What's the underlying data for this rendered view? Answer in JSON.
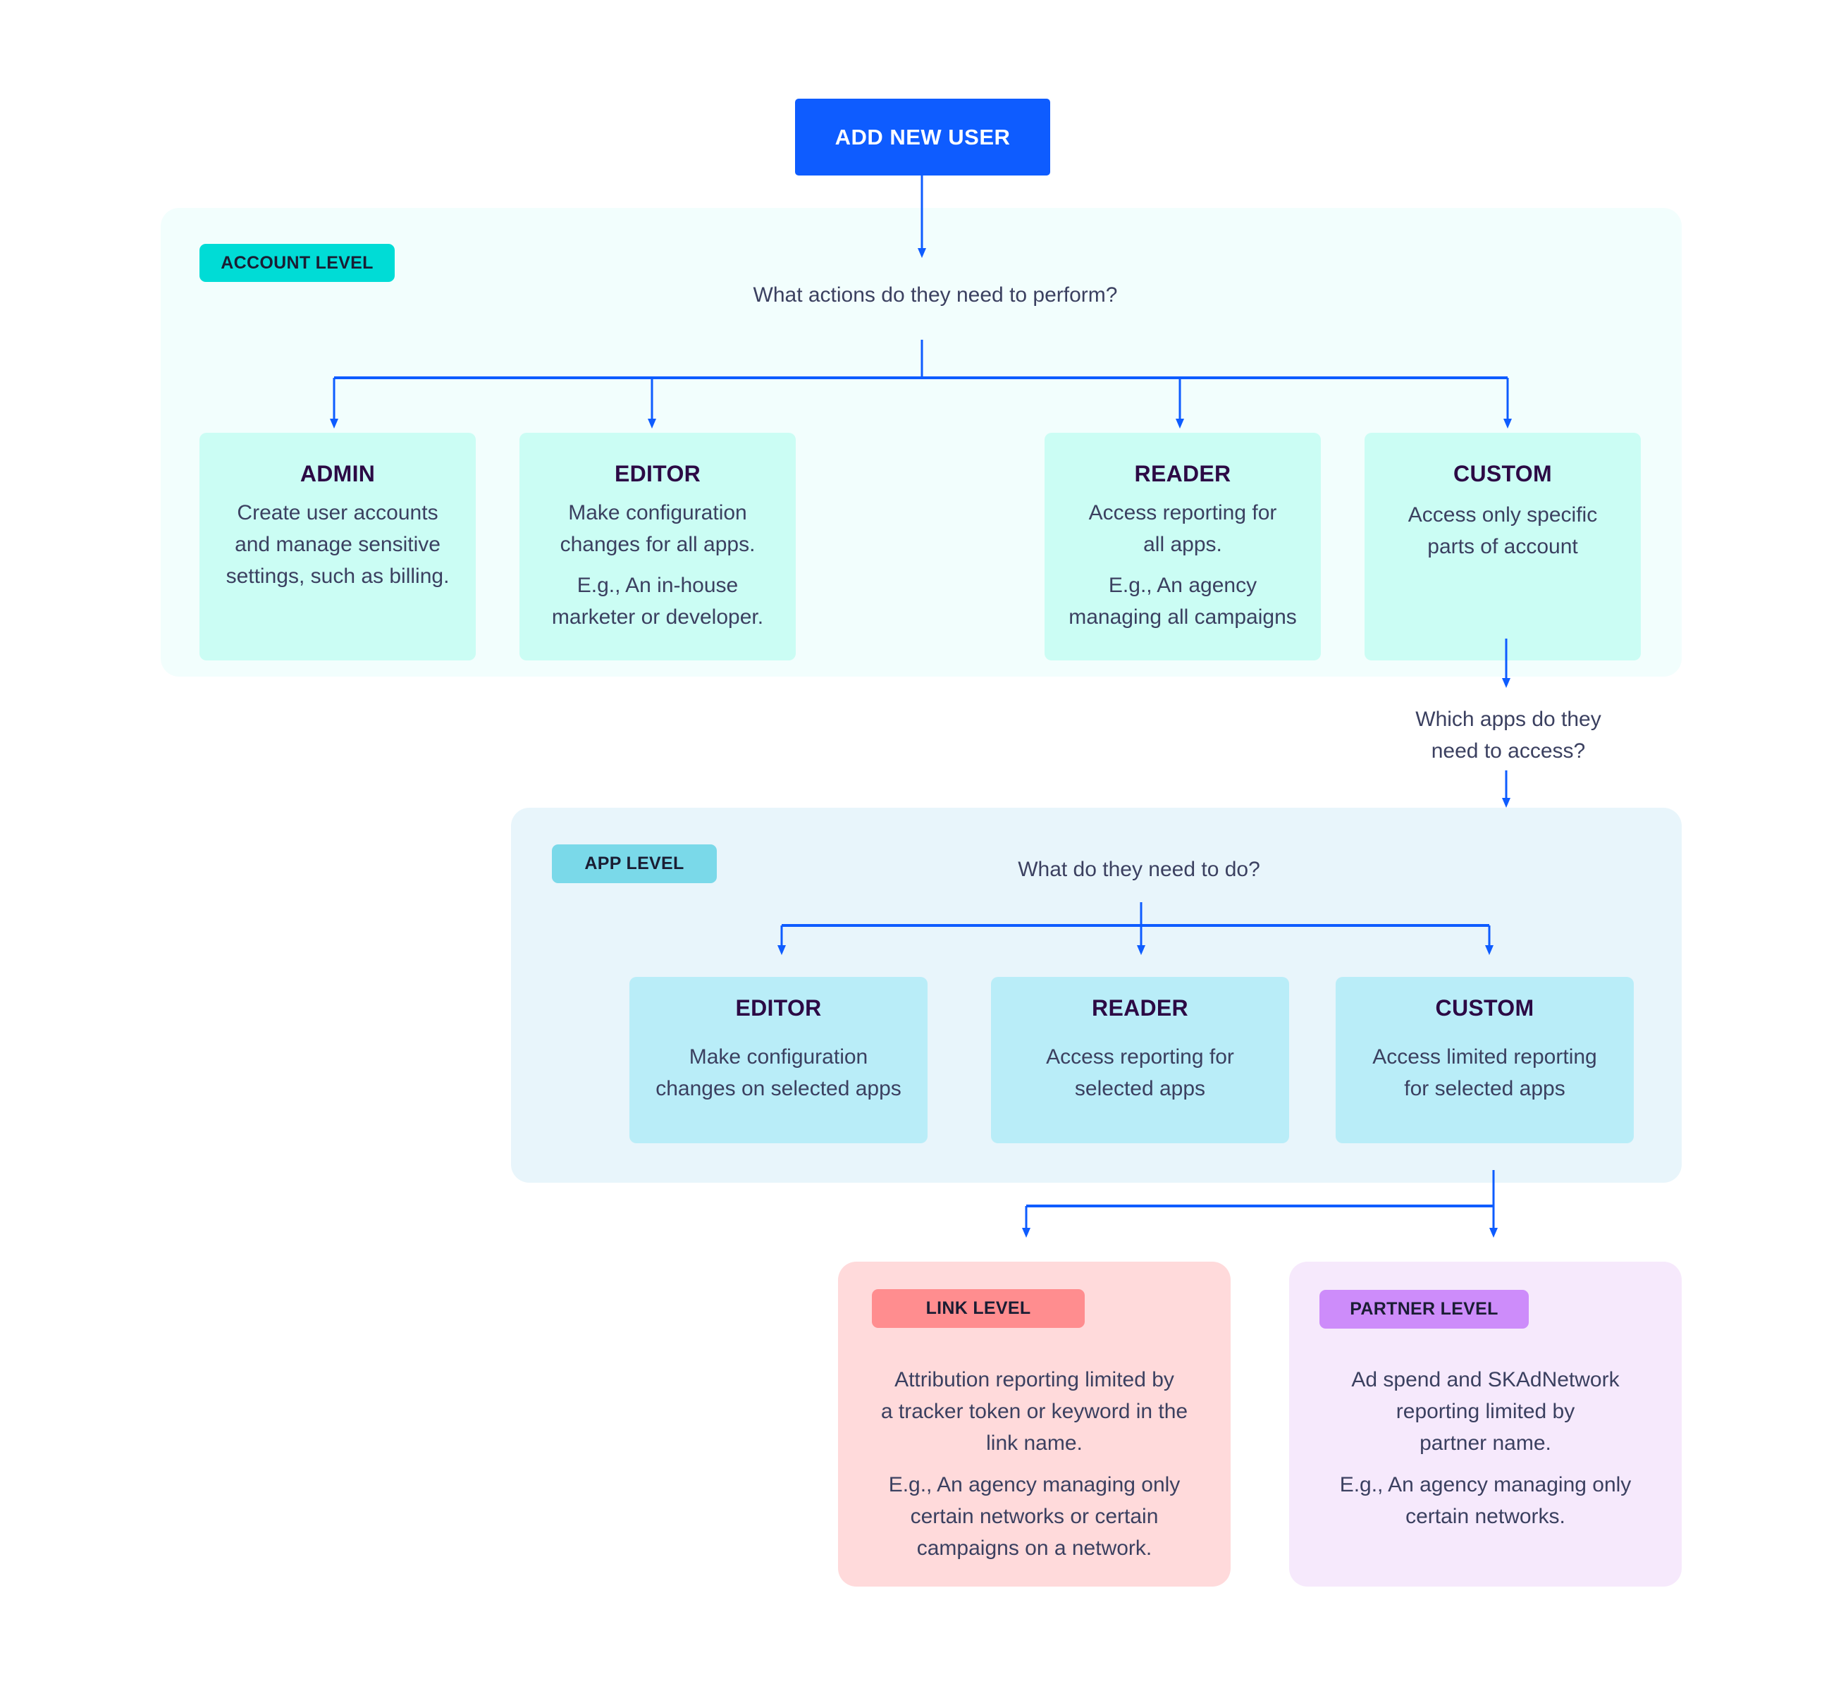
{
  "start_button": {
    "label": "ADD NEW USER"
  },
  "account_level": {
    "tag": "ACCOUNT LEVEL",
    "question": "What actions do they need to perform?",
    "roles": [
      {
        "title": "ADMIN",
        "lines": [
          "Create user accounts",
          "and manage sensitive",
          "settings, such as billing."
        ],
        "example": []
      },
      {
        "title": "EDITOR",
        "lines": [
          "Make configuration",
          "changes for all apps."
        ],
        "example": [
          "E.g., An in-house",
          "marketer or developer."
        ]
      },
      {
        "title": "READER",
        "lines": [
          "Access reporting for",
          "all apps."
        ],
        "example": [
          "E.g., An agency",
          "managing all campaigns"
        ]
      },
      {
        "title": "CUSTOM",
        "lines": [
          "Access only specific",
          "parts of account"
        ],
        "example": []
      }
    ]
  },
  "apps_question": {
    "lines": [
      "Which apps do they",
      "need to access?"
    ]
  },
  "app_level": {
    "tag": "APP LEVEL",
    "question": "What do they need to do?",
    "roles": [
      {
        "title": "EDITOR",
        "lines": [
          "Make configuration",
          "changes on selected apps"
        ]
      },
      {
        "title": "READER",
        "lines": [
          "Access reporting for",
          "selected apps"
        ]
      },
      {
        "title": "CUSTOM",
        "lines": [
          "Access limited reporting",
          "for selected apps"
        ]
      }
    ]
  },
  "link_level": {
    "tag": "LINK LEVEL",
    "lines": [
      "Attribution reporting limited by",
      "a tracker token or keyword in the",
      "link name."
    ],
    "example": [
      "E.g., An agency managing only",
      "certain networks or certain",
      "campaigns on a network."
    ]
  },
  "partner_level": {
    "tag": "PARTNER LEVEL",
    "lines": [
      "Ad spend and SKAdNetwork",
      "reporting limited by",
      "partner name."
    ],
    "example": [
      "E.g., An agency managing only",
      "certain networks."
    ]
  },
  "colors": {
    "accent_blue": "#0e5cff",
    "account_panel": "#f2fefd",
    "account_card": "#cbfdf4",
    "account_tag": "#00dcd6",
    "app_panel": "#e8f5fb",
    "app_card": "#b9edf8",
    "app_tag": "#7ad9e9",
    "link_box": "#ffdadb",
    "link_tag": "#ff8d8f",
    "partner_box": "#f6e9fc",
    "partner_tag": "#cd8cfa",
    "title_text": "#2c0a45",
    "body_text": "#3b4060"
  }
}
